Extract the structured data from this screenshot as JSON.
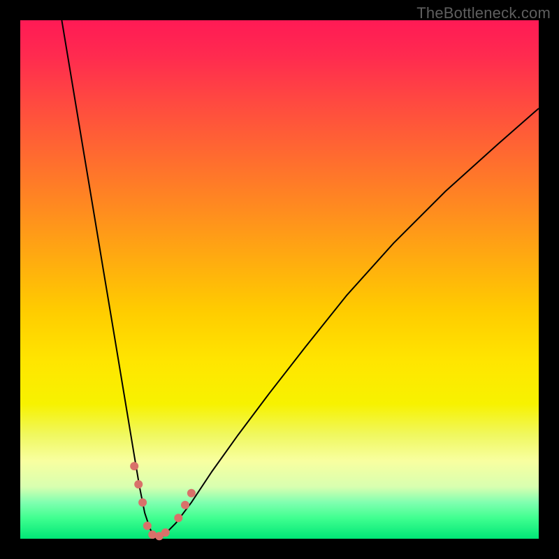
{
  "watermark": "TheBottleneck.com",
  "chart_data": {
    "type": "line",
    "title": "",
    "xlabel": "",
    "ylabel": "",
    "xlim": [
      0,
      100
    ],
    "ylim": [
      0,
      100
    ],
    "series": [
      {
        "name": "curve",
        "x": [
          8,
          10,
          12,
          14,
          16,
          18,
          20,
          22,
          23,
          24,
          25,
          26,
          27,
          28,
          30,
          33,
          37,
          42,
          48,
          55,
          63,
          72,
          82,
          92,
          100
        ],
        "y": [
          100,
          88,
          76,
          64,
          52,
          40,
          28,
          16,
          10,
          5,
          2,
          0,
          0,
          1,
          3,
          7,
          13,
          20,
          28,
          37,
          47,
          57,
          67,
          76,
          83
        ]
      }
    ],
    "markers": [
      {
        "name": "marker-left-1",
        "x": 22.0,
        "y": 14.0
      },
      {
        "name": "marker-left-2",
        "x": 22.8,
        "y": 10.5
      },
      {
        "name": "marker-left-3",
        "x": 23.6,
        "y": 7.0
      },
      {
        "name": "marker-bottom-1",
        "x": 24.5,
        "y": 2.5
      },
      {
        "name": "marker-bottom-2",
        "x": 25.5,
        "y": 0.8
      },
      {
        "name": "marker-bottom-3",
        "x": 26.8,
        "y": 0.5
      },
      {
        "name": "marker-bottom-4",
        "x": 28.0,
        "y": 1.2
      },
      {
        "name": "marker-right-1",
        "x": 30.5,
        "y": 4.0
      },
      {
        "name": "marker-right-2",
        "x": 31.8,
        "y": 6.5
      },
      {
        "name": "marker-right-3",
        "x": 33.0,
        "y": 8.8
      }
    ],
    "marker_style": {
      "color": "#d9716a",
      "radius_px": 6
    }
  }
}
